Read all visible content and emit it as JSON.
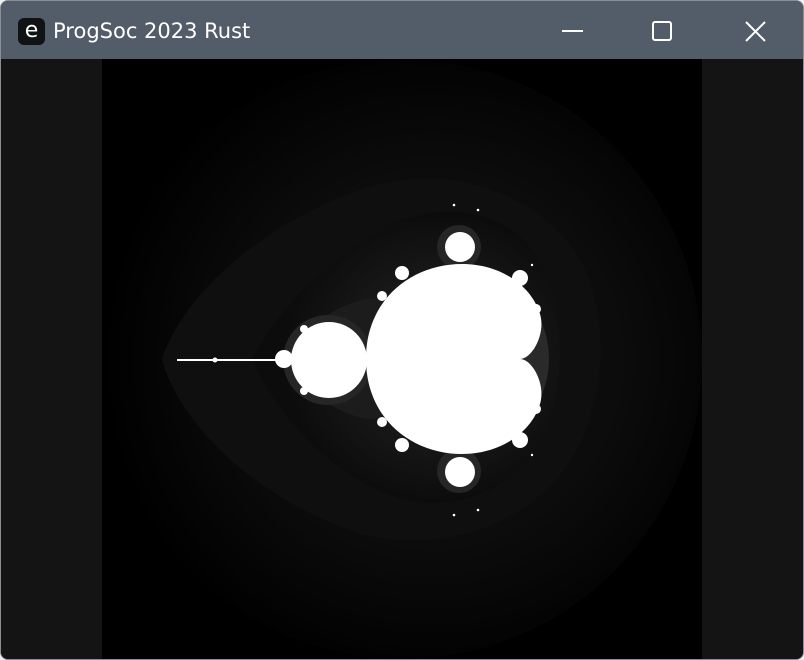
{
  "window": {
    "title": "ProgSoc 2023 Rust",
    "app_icon_glyph": "e",
    "titlebar_color": "#535c69",
    "title_color": "#ffffff"
  },
  "controls": {
    "minimize_icon": "minimize-icon",
    "maximize_icon": "maximize-icon",
    "close_icon": "close-icon"
  },
  "canvas": {
    "content": "mandelbrot-set",
    "background_color": "#000000",
    "set_color": "#ffffff",
    "margin_color": "#141414"
  }
}
